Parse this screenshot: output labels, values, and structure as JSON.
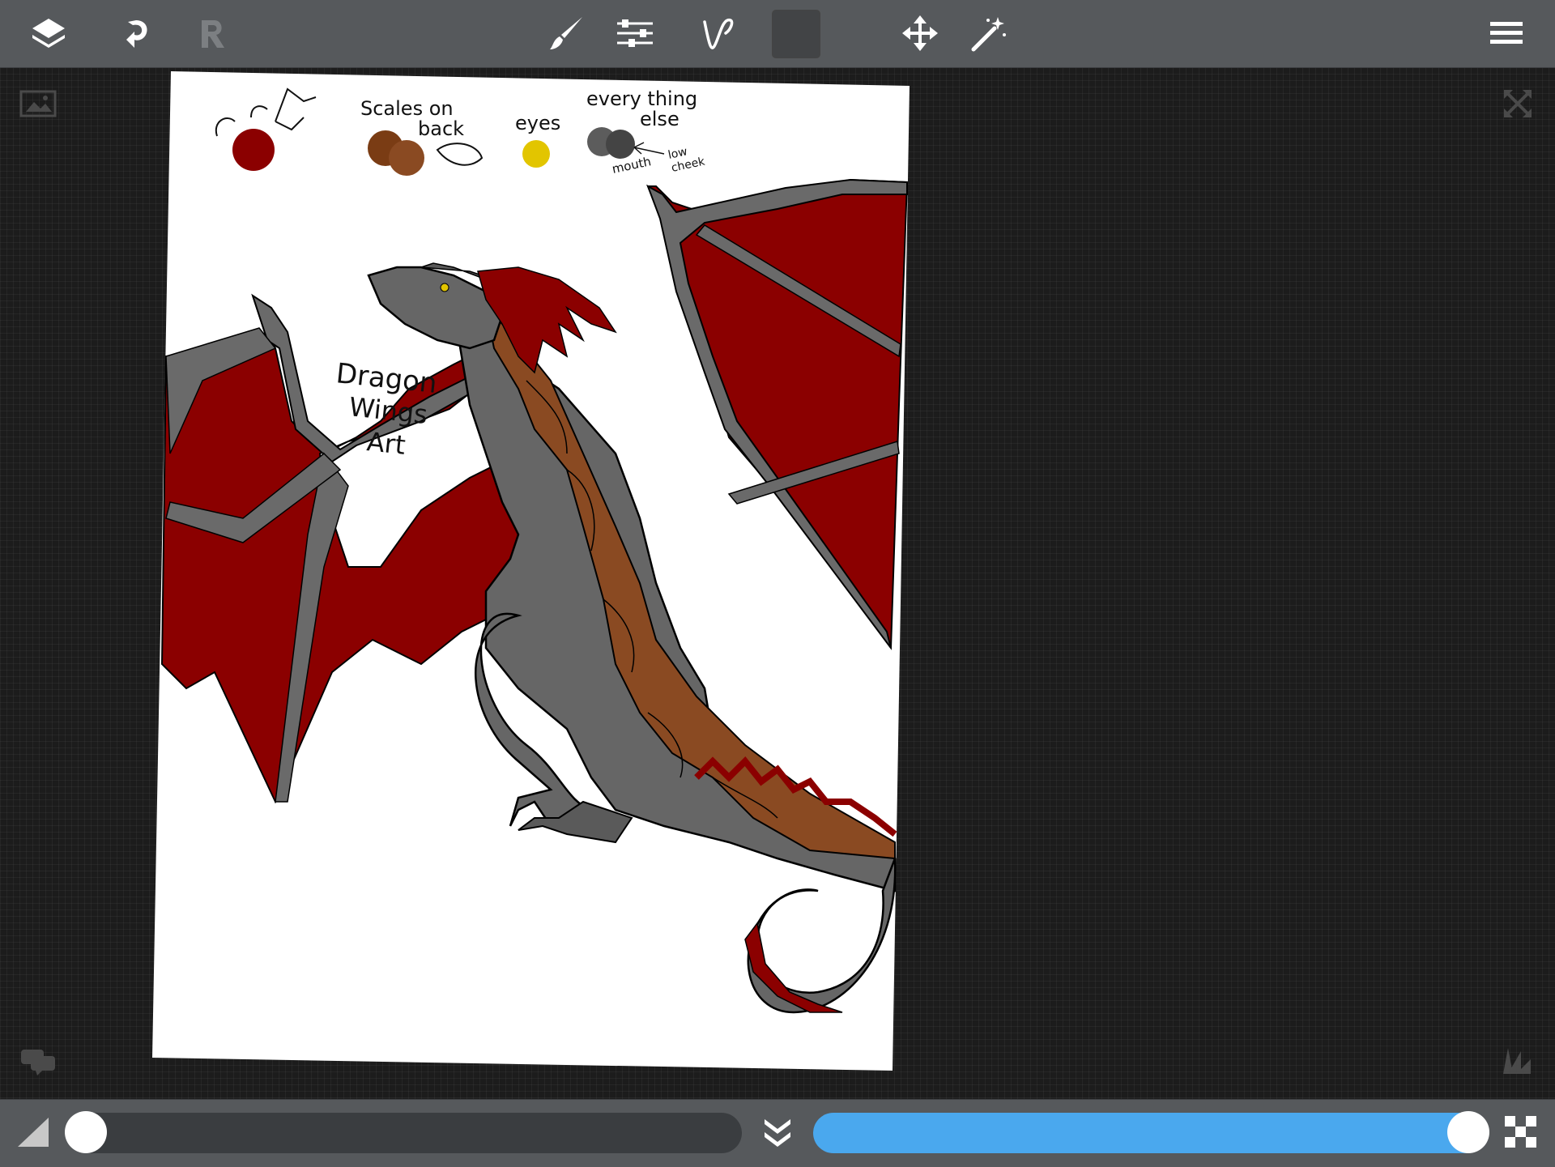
{
  "colors": {
    "toolbar": "#56595c",
    "accent": "#4aa8ee",
    "current_color": "#424446",
    "wing_red": "#8b0000",
    "scale_brown": "#8a4a22",
    "body_gray": "#666666",
    "eye_yellow": "#e2c500"
  },
  "toolbar": {
    "icons": [
      "layers-icon",
      "undo-icon",
      "redo-icon",
      "brush-icon",
      "adjustments-icon",
      "stroke-icon",
      "color-swatch",
      "move-icon",
      "magic-wand-icon",
      "menu-icon"
    ]
  },
  "canvas": {
    "notes": {
      "scales_line1": "Scales on",
      "scales_line2": "back",
      "eyes": "eyes",
      "everything_line1": "every thing",
      "everything_line2": "else",
      "mouth": "mouth",
      "low": "low",
      "cheek": "cheek",
      "title_line1": "Dragon",
      "title_line2": "Wings",
      "title_line3": "Art"
    }
  },
  "bottom": {
    "brush_size": 0.0,
    "opacity": 1.0
  }
}
